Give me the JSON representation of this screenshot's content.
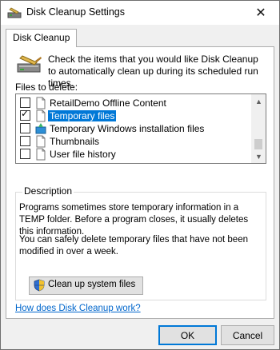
{
  "window": {
    "title": "Disk Cleanup Settings",
    "close_glyph": "✕"
  },
  "tab": {
    "label": "Disk Cleanup"
  },
  "intro": {
    "text": "Check the items that you would like Disk Cleanup to automatically clean up during its scheduled run times."
  },
  "files": {
    "label": "Files to delete:",
    "items": [
      {
        "label": "RetailDemo Offline Content",
        "checked": false,
        "selected": false,
        "icon": "file-icon"
      },
      {
        "label": "Temporary files",
        "checked": true,
        "selected": true,
        "icon": "file-icon"
      },
      {
        "label": "Temporary Windows installation files",
        "checked": false,
        "selected": false,
        "icon": "windows-setup-icon"
      },
      {
        "label": "Thumbnails",
        "checked": false,
        "selected": false,
        "icon": "file-icon"
      },
      {
        "label": "User file history",
        "checked": false,
        "selected": false,
        "icon": "file-icon"
      }
    ],
    "scroll_up": "▲",
    "scroll_down": "▼",
    "check_mark": "✓"
  },
  "description": {
    "title": "Description",
    "p1": "Programs sometimes store temporary information in a TEMP folder. Before a program closes, it usually deletes this information.",
    "p2": "You can safely delete temporary files that have not been modified in over a week.",
    "cleanup_button": "Clean up system files"
  },
  "help_link": "How does Disk Cleanup work?",
  "buttons": {
    "ok": "OK",
    "cancel": "Cancel"
  },
  "colors": {
    "selection": "#0078d7",
    "link": "#0066cc"
  }
}
